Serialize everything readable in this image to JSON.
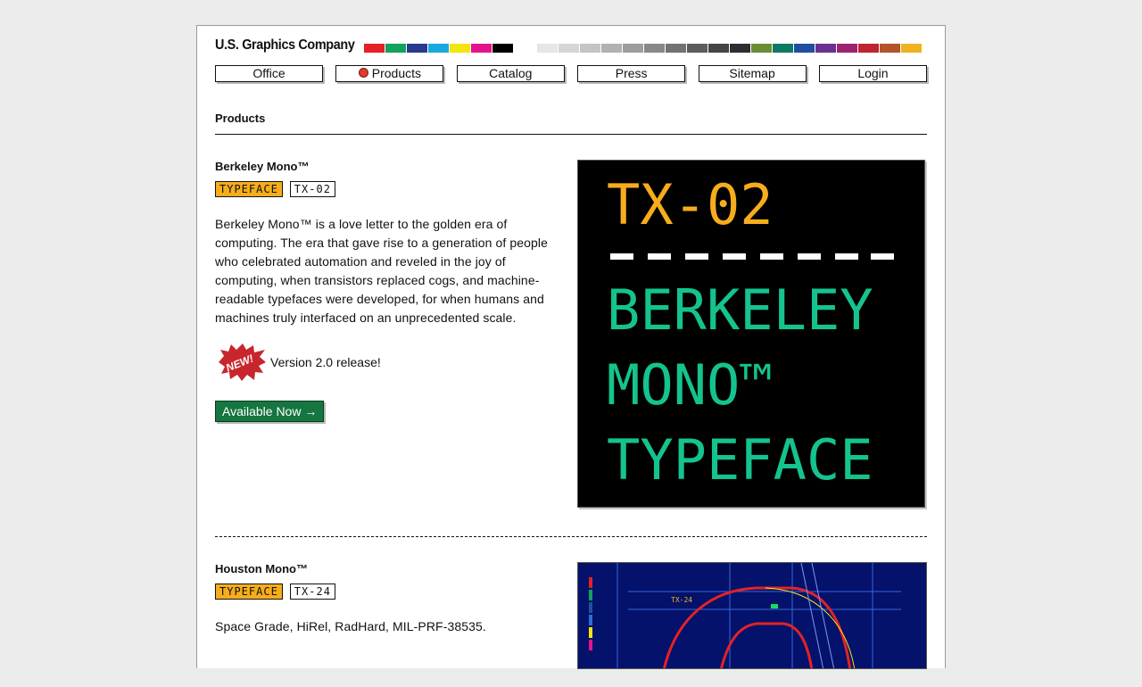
{
  "brand": {
    "name": "U.S. Graphics Company"
  },
  "swatches": {
    "primary": [
      "#e42127",
      "#11a25b",
      "#2a3a8f",
      "#19a9e1",
      "#f5e50e",
      "#e4148b",
      "#000000"
    ],
    "grays": [
      "#e6e6e6",
      "#d6d6d6",
      "#c4c4c4",
      "#b1b1b1",
      "#9d9d9d",
      "#888888",
      "#727272",
      "#5c5c5c",
      "#454545",
      "#2e2e2e",
      "#6a8e35",
      "#0f7a63",
      "#224ea0",
      "#6a3190",
      "#9d2270",
      "#c02431",
      "#b5532b",
      "#efb322"
    ]
  },
  "nav": [
    {
      "label": "Office",
      "active": false
    },
    {
      "label": "Products",
      "active": true
    },
    {
      "label": "Catalog",
      "active": false
    },
    {
      "label": "Press",
      "active": false
    },
    {
      "label": "Sitemap",
      "active": false
    },
    {
      "label": "Login",
      "active": false
    }
  ],
  "section": {
    "title": "Products"
  },
  "products": [
    {
      "name": "Berkeley Mono™",
      "tag_type": "TYPEFACE",
      "tag_code": "TX-02",
      "description": "Berkeley Mono™ is a love letter to the golden era of computing. The era that gave rise to a generation of people who celebrated automation and reveled in the joy of computing, when transistors replaced cogs, and machine-readable typefaces were developed, for when humans and machines truly interfaced on an unprecedented scale.",
      "badge": "NEW!",
      "release": "Version 2.0 release!",
      "cta": "Available Now →",
      "hero": {
        "code": "TX-02",
        "dashes": "— — — — — — — —",
        "line1": "BERKELEY",
        "line2": "MONO™",
        "line3": "TYPEFACE"
      }
    },
    {
      "name": "Houston Mono™",
      "tag_type": "TYPEFACE",
      "tag_code": "TX-24",
      "description": "Space Grade, HiRel, RadHard, MIL-PRF-38535.",
      "hero_label": "TX-24"
    }
  ],
  "colors": {
    "accent": "#f6ad1c",
    "green": "#14c38e",
    "cta": "#15763f",
    "badge": "#c8262d"
  }
}
